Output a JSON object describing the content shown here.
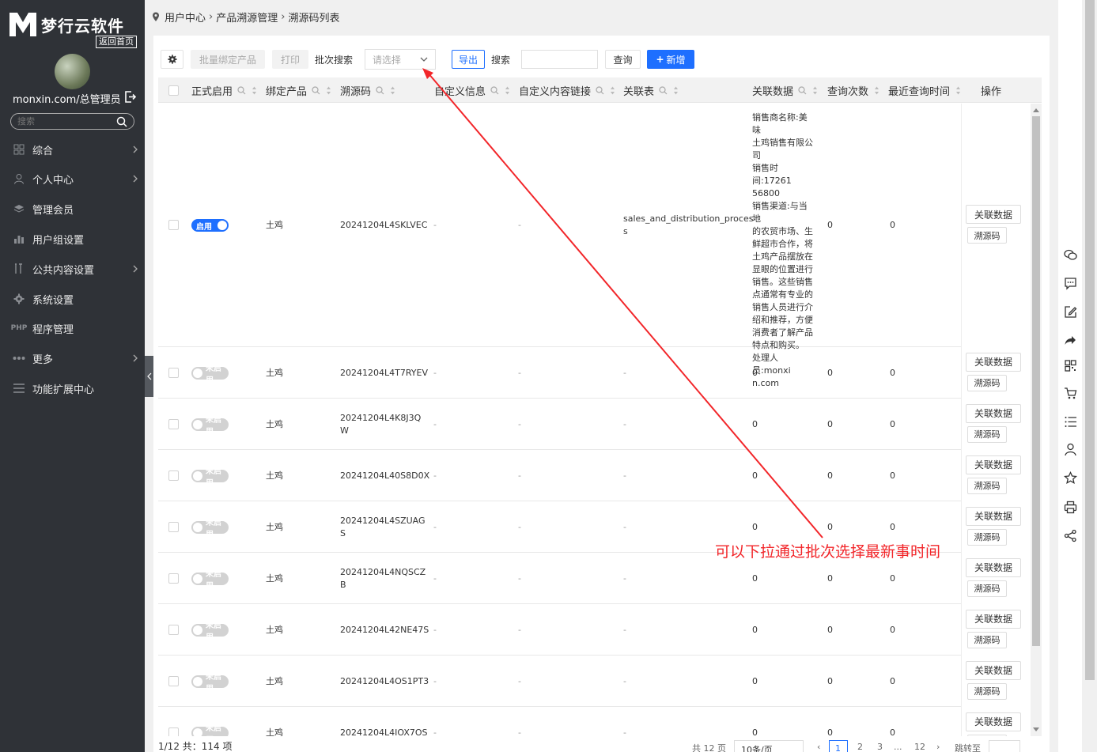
{
  "brand": {
    "name": "梦行云软件",
    "home_link": "返回首页"
  },
  "user": {
    "name": "monxin.com/总管理员"
  },
  "sidebar": {
    "search_placeholder": "搜索",
    "items": [
      {
        "label": "综合",
        "icon": "grid-icon"
      },
      {
        "label": "个人中心",
        "icon": "user-icon"
      },
      {
        "label": "管理会员",
        "icon": "layers-icon"
      },
      {
        "label": "用户组设置",
        "icon": "chart-icon"
      },
      {
        "label": "公共内容设置",
        "icon": "tools-icon"
      },
      {
        "label": "系统设置",
        "icon": "gear-icon"
      },
      {
        "label": "程序管理",
        "icon": "php-icon"
      },
      {
        "label": "更多",
        "icon": "dots-icon"
      },
      {
        "label": "功能扩展中心",
        "icon": "menu-icon"
      }
    ]
  },
  "breadcrumb": [
    "用户中心",
    "产品溯源管理",
    "溯源码列表"
  ],
  "toolbar": {
    "bind_label": "批量绑定产品",
    "print_label": "打印",
    "batch_search_label": "批次搜索",
    "select_placeholder": "请选择",
    "export_label": "导出",
    "search_label": "搜索",
    "query_label": "查询",
    "add_label": "新增"
  },
  "columns": [
    "正式启用",
    "绑定产品",
    "溯源码",
    "自定义信息",
    "自定义内容链接",
    "关联表",
    "关联数据",
    "查询次数",
    "最近查询时间",
    "操作"
  ],
  "rows": [
    {
      "status": "启用",
      "product": "土鸡",
      "code_l1": "20241204L4SKLVEC",
      "code_l2": "",
      "custom_info": "-",
      "custom_link": "-",
      "table_l1": "sales_and_distribution_proces",
      "table_l2": "s",
      "data_lines": [
        "销售商名称:美味",
        "土鸡销售有限公",
        "司",
        "销售时间:17261",
        "56800",
        "销售渠道:与当地",
        "的农贸市场、生",
        "鲜超市合作，将",
        "土鸡产品摆放在",
        "显眼的位置进行",
        "销售。这些销售",
        "点通常有专业的",
        "销售人员进行介",
        "绍和推荐，方便",
        "消费者了解产品",
        "特点和购买。",
        "处理人员:monxi",
        "n.com"
      ],
      "count": "0",
      "last": "0"
    },
    {
      "status": "未启用",
      "product": "土鸡",
      "code_l1": "20241204L4T7RYEV",
      "code_l2": "",
      "custom_info": "-",
      "custom_link": "-",
      "table_l1": "-",
      "table_l2": "",
      "data_lines": [
        "0"
      ],
      "count": "0",
      "last": "0"
    },
    {
      "status": "未启用",
      "product": "土鸡",
      "code_l1": "20241204L4K8J3Q",
      "code_l2": "W",
      "custom_info": "-",
      "custom_link": "-",
      "table_l1": "-",
      "table_l2": "",
      "data_lines": [
        "0"
      ],
      "count": "0",
      "last": "0"
    },
    {
      "status": "未启用",
      "product": "土鸡",
      "code_l1": "20241204L40S8D0X",
      "code_l2": "",
      "custom_info": "-",
      "custom_link": "-",
      "table_l1": "-",
      "table_l2": "",
      "data_lines": [
        "0"
      ],
      "count": "0",
      "last": "0"
    },
    {
      "status": "未启用",
      "product": "土鸡",
      "code_l1": "20241204L4SZUAG",
      "code_l2": "S",
      "custom_info": "-",
      "custom_link": "-",
      "table_l1": "-",
      "table_l2": "",
      "data_lines": [
        "0"
      ],
      "count": "0",
      "last": "0"
    },
    {
      "status": "未启用",
      "product": "土鸡",
      "code_l1": "20241204L4NQSCZ",
      "code_l2": "B",
      "custom_info": "-",
      "custom_link": "-",
      "table_l1": "-",
      "table_l2": "",
      "data_lines": [
        "0"
      ],
      "count": "0",
      "last": "0"
    },
    {
      "status": "未启用",
      "product": "土鸡",
      "code_l1": "20241204L42NE47S",
      "code_l2": "",
      "custom_info": "-",
      "custom_link": "-",
      "table_l1": "-",
      "table_l2": "",
      "data_lines": [
        "0"
      ],
      "count": "0",
      "last": "0"
    },
    {
      "status": "未启用",
      "product": "土鸡",
      "code_l1": "20241204L4OS1PT3",
      "code_l2": "",
      "custom_info": "-",
      "custom_link": "-",
      "table_l1": "-",
      "table_l2": "",
      "data_lines": [
        "0"
      ],
      "count": "0",
      "last": "0"
    },
    {
      "status": "未启用",
      "product": "土鸡",
      "code_l1": "20241204L4IOX7OS",
      "code_l2": "",
      "custom_info": "-",
      "custom_link": "-",
      "table_l1": "-",
      "table_l2": "",
      "data_lines": [
        "0"
      ],
      "count": "0",
      "last": "0"
    }
  ],
  "row_actions": {
    "related_label": "关联数据",
    "trace_label": "溯源码"
  },
  "footer": {
    "summary": "1/12 共：114 项",
    "total_pages": "共 12 页",
    "page_size": "10条/页",
    "pages": [
      "1",
      "2",
      "3",
      "...",
      "12"
    ],
    "jump_label": "跳转至"
  },
  "annotation": {
    "text": "可以下拉通过批次选择最新事时间",
    "color": "#f2262a"
  },
  "colors": {
    "sidebar_bg": "#2f3237",
    "primary": "#1e6fff",
    "toggle_on": "#1e6fff",
    "toggle_off": "#d2d2d2"
  },
  "right_toolbar": [
    "wechat-icon",
    "message-icon",
    "edit-icon",
    "share-arrow-icon",
    "qrcode-icon",
    "cart-icon",
    "list-icon",
    "user-icon",
    "star-icon",
    "print-icon",
    "share-icon"
  ]
}
